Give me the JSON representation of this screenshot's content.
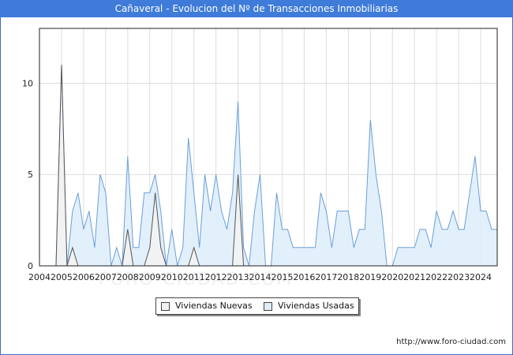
{
  "window": {
    "title": "Cañaveral - Evolucion del Nº de Transacciones Inmobiliarias"
  },
  "footer": {
    "source": "http://www.foro-ciudad.com",
    "watermark": "FORO-CIUDAD.COM"
  },
  "legend": {
    "placement": "bottom-center"
  },
  "colors": {
    "title_bg": "#3f7bd9",
    "nuevas_fill": "#f2f2f2",
    "nuevas_line": "#555555",
    "usadas_fill": "#dfeefb",
    "usadas_line": "#6a9fd8",
    "grid": "#dddddd"
  },
  "chart_data": {
    "type": "area",
    "title": "Cañaveral - Evolucion del Nº de Transacciones Inmobiliarias",
    "xlabel": "",
    "ylabel": "",
    "xlim": [
      2004,
      2024.75
    ],
    "ylim": [
      0,
      13
    ],
    "grid": true,
    "x_ticks": [
      "2004",
      "2005",
      "2006",
      "2007",
      "2008",
      "2009",
      "2010",
      "2011",
      "2012",
      "2013",
      "2014",
      "2015",
      "2016",
      "2017",
      "2018",
      "2019",
      "2020",
      "2021",
      "2022",
      "2023",
      "2024"
    ],
    "y_ticks": [
      "0",
      "5",
      "10"
    ],
    "y_tick_values": [
      0,
      5,
      10
    ],
    "series": [
      {
        "name": "Viviendas Nuevas",
        "points": [
          [
            2004.75,
            0
          ],
          [
            2005.0,
            11
          ],
          [
            2005.25,
            0
          ],
          [
            2005.5,
            1
          ],
          [
            2005.75,
            0
          ],
          [
            2006.0,
            0
          ],
          [
            2006.25,
            0
          ],
          [
            2006.5,
            0
          ],
          [
            2006.75,
            0
          ],
          [
            2007.0,
            0
          ],
          [
            2007.25,
            0
          ],
          [
            2007.5,
            0
          ],
          [
            2007.75,
            0
          ],
          [
            2008.0,
            2
          ],
          [
            2008.25,
            0
          ],
          [
            2008.5,
            0
          ],
          [
            2008.75,
            0
          ],
          [
            2009.0,
            1
          ],
          [
            2009.25,
            4
          ],
          [
            2009.5,
            1
          ],
          [
            2009.75,
            0
          ],
          [
            2010.0,
            0
          ],
          [
            2010.25,
            0
          ],
          [
            2010.5,
            0
          ],
          [
            2010.75,
            0
          ],
          [
            2011.0,
            1
          ],
          [
            2011.25,
            0
          ],
          [
            2011.5,
            0
          ],
          [
            2011.75,
            0
          ],
          [
            2012.0,
            0
          ],
          [
            2012.25,
            0
          ],
          [
            2012.5,
            0
          ],
          [
            2012.75,
            0
          ],
          [
            2013.0,
            5
          ],
          [
            2013.25,
            0
          ],
          [
            2013.5,
            0
          ]
        ]
      },
      {
        "name": "Viviendas Usadas",
        "points": [
          [
            2004.75,
            0
          ],
          [
            2005.0,
            11
          ],
          [
            2005.25,
            0
          ],
          [
            2005.5,
            3
          ],
          [
            2005.75,
            4
          ],
          [
            2006.0,
            2
          ],
          [
            2006.25,
            3
          ],
          [
            2006.5,
            1
          ],
          [
            2006.75,
            5
          ],
          [
            2007.0,
            4
          ],
          [
            2007.25,
            0
          ],
          [
            2007.5,
            1
          ],
          [
            2007.75,
            0
          ],
          [
            2008.0,
            6
          ],
          [
            2008.25,
            1
          ],
          [
            2008.5,
            1
          ],
          [
            2008.75,
            4
          ],
          [
            2009.0,
            4
          ],
          [
            2009.25,
            5
          ],
          [
            2009.5,
            3
          ],
          [
            2009.75,
            0
          ],
          [
            2010.0,
            2
          ],
          [
            2010.25,
            0
          ],
          [
            2010.5,
            1
          ],
          [
            2010.75,
            7
          ],
          [
            2011.0,
            4
          ],
          [
            2011.25,
            1
          ],
          [
            2011.5,
            5
          ],
          [
            2011.75,
            3
          ],
          [
            2012.0,
            5
          ],
          [
            2012.25,
            3
          ],
          [
            2012.5,
            2
          ],
          [
            2012.75,
            4
          ],
          [
            2013.0,
            9
          ],
          [
            2013.25,
            1
          ],
          [
            2013.5,
            0
          ],
          [
            2013.75,
            3
          ],
          [
            2014.0,
            5
          ],
          [
            2014.25,
            0
          ],
          [
            2014.5,
            0
          ],
          [
            2014.75,
            4
          ],
          [
            2015.0,
            2
          ],
          [
            2015.25,
            2
          ],
          [
            2015.5,
            1
          ],
          [
            2015.75,
            1
          ],
          [
            2016.0,
            1
          ],
          [
            2016.25,
            1
          ],
          [
            2016.5,
            1
          ],
          [
            2016.75,
            4
          ],
          [
            2017.0,
            3
          ],
          [
            2017.25,
            1
          ],
          [
            2017.5,
            3
          ],
          [
            2017.75,
            3
          ],
          [
            2018.0,
            3
          ],
          [
            2018.25,
            1
          ],
          [
            2018.5,
            2
          ],
          [
            2018.75,
            2
          ],
          [
            2019.0,
            8
          ],
          [
            2019.25,
            5
          ],
          [
            2019.5,
            3
          ],
          [
            2019.75,
            0
          ],
          [
            2020.0,
            0
          ],
          [
            2020.25,
            1
          ],
          [
            2020.5,
            1
          ],
          [
            2020.75,
            1
          ],
          [
            2021.0,
            1
          ],
          [
            2021.25,
            2
          ],
          [
            2021.5,
            2
          ],
          [
            2021.75,
            1
          ],
          [
            2022.0,
            3
          ],
          [
            2022.25,
            2
          ],
          [
            2022.5,
            2
          ],
          [
            2022.75,
            3
          ],
          [
            2023.0,
            2
          ],
          [
            2023.25,
            2
          ],
          [
            2023.5,
            4
          ],
          [
            2023.75,
            6
          ],
          [
            2024.0,
            3
          ],
          [
            2024.25,
            3
          ],
          [
            2024.5,
            2
          ],
          [
            2024.75,
            2
          ]
        ]
      }
    ]
  }
}
